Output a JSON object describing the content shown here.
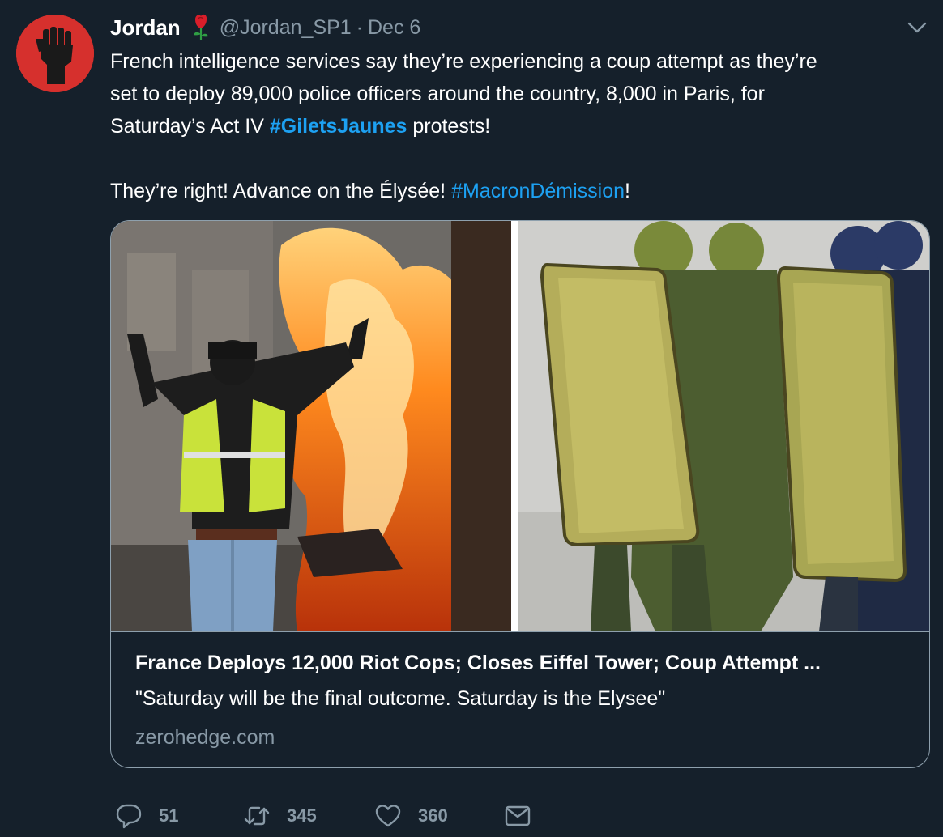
{
  "tweet": {
    "author": {
      "name": "Jordan",
      "handle": "@Jordan_SP1",
      "avatar_icon": "raised-fist-icon",
      "avatar_color": "#d6302d",
      "badge_icon": "rose-icon"
    },
    "separator": "·",
    "date": "Dec 6",
    "text": {
      "line1": "French intelligence services say they’re experiencing a coup attempt as they’re",
      "line2": "set to deploy 89,000 police officers around the country, 8,000 in Paris, for",
      "line3_prefix": "Saturday’s Act IV ",
      "hashtag1": "#GiletsJaunes",
      "line3_suffix": " protests!",
      "line5_prefix": "They’re right! Advance on the Élysée! ",
      "hashtag2": "#MacronDémission",
      "line5_suffix": "!"
    },
    "card": {
      "title": "France Deploys 12,000 Riot Cops; Closes Eiffel Tower; Coup Attempt ...",
      "description": "\"Saturday will be the final outcome. Saturday is the Elysee\"",
      "domain": "zerohedge.com"
    },
    "actions": {
      "replies": "51",
      "retweets": "345",
      "likes": "360"
    }
  },
  "colors": {
    "background": "#15202b",
    "link": "#1da1f2",
    "secondary_text": "#8899a6",
    "card_border": "#8ea0ad"
  }
}
